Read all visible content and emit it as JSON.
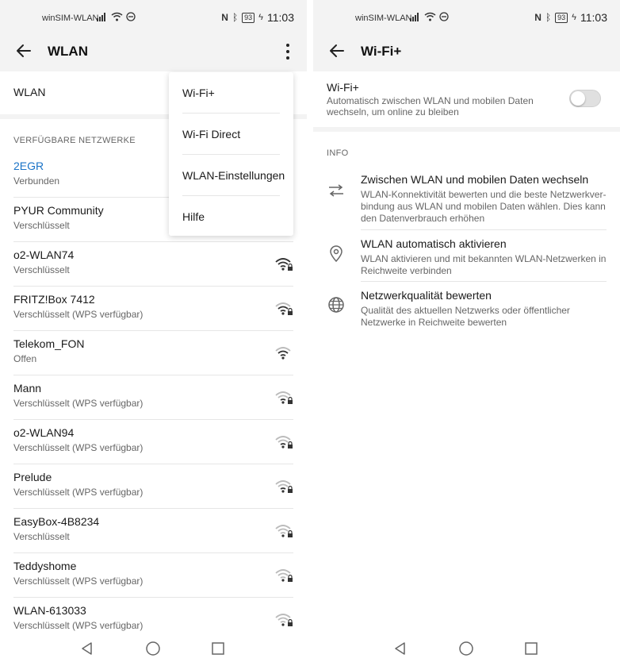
{
  "status_bar": {
    "carrier": "winSIM-WLAN",
    "battery": "93",
    "time": "11:03"
  },
  "left": {
    "title": "WLAN",
    "wlan_toggle_label": "WLAN",
    "section_header": "VERFÜGBARE NETZWERKE",
    "networks": [
      {
        "name": "2EGR",
        "status": "Verbunden"
      },
      {
        "name": "PYUR Community",
        "status": "Verschlüsselt"
      },
      {
        "name": "o2-WLAN74",
        "status": "Verschlüsselt"
      },
      {
        "name": "FRITZ!Box 7412",
        "status": "Verschlüsselt (WPS verfügbar)"
      },
      {
        "name": "Telekom_FON",
        "status": "Offen"
      },
      {
        "name": "Mann",
        "status": "Verschlüsselt (WPS verfügbar)"
      },
      {
        "name": "o2-WLAN94",
        "status": "Verschlüsselt (WPS verfügbar)"
      },
      {
        "name": "Prelude",
        "status": "Verschlüsselt (WPS verfügbar)"
      },
      {
        "name": "EasyBox-4B8234",
        "status": "Verschlüsselt"
      },
      {
        "name": "Teddyshome",
        "status": "Verschlüsselt (WPS verfügbar)"
      },
      {
        "name": "WLAN-613033",
        "status": "Verschlüsselt (WPS verfügbar)"
      }
    ],
    "menu": [
      "Wi-Fi+",
      "Wi-Fi Direct",
      "WLAN-Einstellungen",
      "Hilfe"
    ]
  },
  "right": {
    "title": "Wi-Fi+",
    "wifiplus": {
      "title": "Wi-Fi+",
      "description": "Automatisch zwischen WLAN und mobilen Daten wechseln, um online zu bleiben",
      "enabled": false
    },
    "info_header": "INFO",
    "info_items": [
      {
        "icon": "swap-arrows-icon",
        "title": "Zwischen WLAN und mobilen Daten wechseln",
        "description": "WLAN-Konnektivität bewerten und die beste Netzwerkver-bindung aus WLAN und mobilen Daten wählen. Dies kann den Datenverbrauch erhöhen"
      },
      {
        "icon": "location-pin-icon",
        "title": "WLAN automatisch aktivieren",
        "description": "WLAN aktivieren und mit bekannten WLAN-Netzwerken in Reichweite verbinden"
      },
      {
        "icon": "globe-icon",
        "title": "Netzwerkqualität bewerten",
        "description": "Qualität des aktuellen Netzwerks oder öffentlicher Netzwerke in Reichweite bewerten"
      }
    ]
  }
}
